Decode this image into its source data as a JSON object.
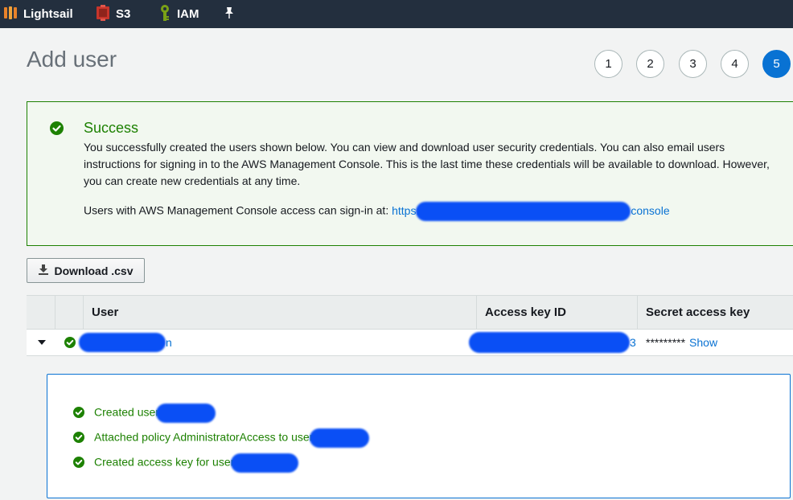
{
  "nav": {
    "items": [
      {
        "label": "Lightsail",
        "icon": "lightsail-icon"
      },
      {
        "label": "S3",
        "icon": "s3-icon"
      },
      {
        "label": "IAM",
        "icon": "iam-icon"
      }
    ],
    "pin_icon": "pin-icon"
  },
  "page": {
    "title": "Add user",
    "steps": [
      "1",
      "2",
      "3",
      "4",
      "5"
    ],
    "active_step": "5"
  },
  "success": {
    "title": "Success",
    "text": "You successfully created the users shown below. You can view and download user security credentials. You can also email users instructions for signing in to the AWS Management Console. This is the last time these credentials will be available to download. However, you can create new credentials at any time.",
    "signin_prefix": "Users with AWS Management Console access can sign-in at:",
    "signin_url_start": "https:",
    "signin_url_end": "console"
  },
  "download_button": {
    "label": "Download .csv"
  },
  "table": {
    "columns": [
      "User",
      "Access key ID",
      "Secret access key"
    ],
    "rows": [
      {
        "user_suffix": "n",
        "access_key_suffix": "3",
        "secret": "*********",
        "show_label": "Show"
      }
    ]
  },
  "details": {
    "lines": [
      "Created user",
      "Attached policy AdministratorAccess to user",
      "Created access key for user"
    ]
  },
  "colors": {
    "nav_bg": "#232f3e",
    "success_green": "#1d8102",
    "link_blue": "#0972d3",
    "redaction_blue": "#0a4ff5"
  }
}
